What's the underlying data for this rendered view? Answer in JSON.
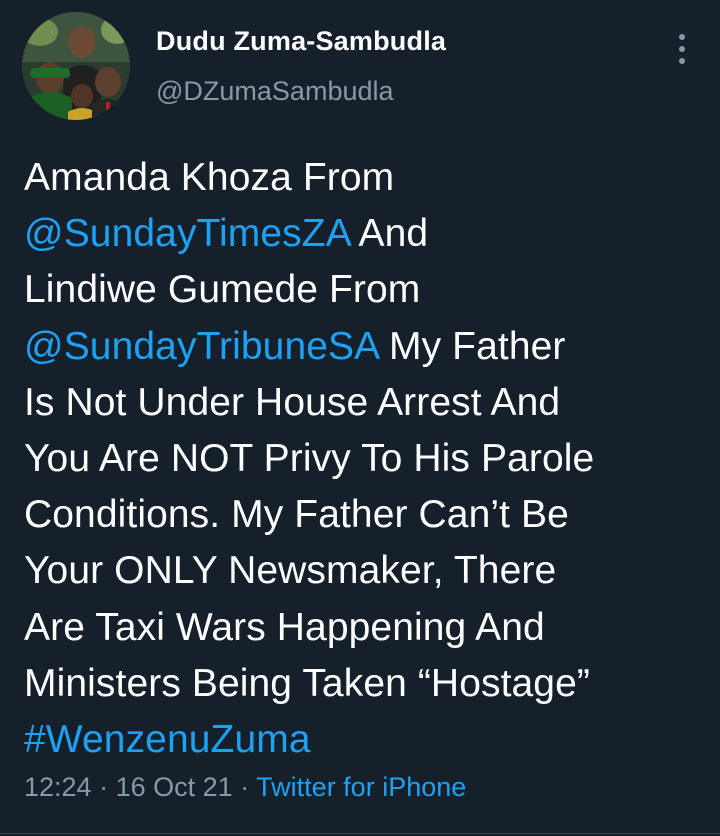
{
  "author": {
    "display_name": "Dudu Zuma-Sambudla",
    "handle": "@DZumaSambudla"
  },
  "menu": {
    "icon": "more-vertical-icon"
  },
  "tweet": {
    "lines": [
      [
        {
          "t": "Amanda Khoza From",
          "k": "text"
        }
      ],
      [
        {
          "t": "@SundayTimesZA",
          "k": "mention"
        },
        {
          "t": " And",
          "k": "text"
        }
      ],
      [
        {
          "t": "Lindiwe Gumede From",
          "k": "text"
        }
      ],
      [
        {
          "t": "@SundayTribuneSA",
          "k": "mention"
        },
        {
          "t": " My Father",
          "k": "text"
        }
      ],
      [
        {
          "t": "Is Not Under House Arrest And",
          "k": "text"
        }
      ],
      [
        {
          "t": "You Are NOT Privy To His Parole",
          "k": "text"
        }
      ],
      [
        {
          "t": "Conditions. My Father Can’t Be",
          "k": "text"
        }
      ],
      [
        {
          "t": "Your ONLY Newsmaker, There",
          "k": "text"
        }
      ],
      [
        {
          "t": "Are Taxi Wars Happening And",
          "k": "text"
        }
      ],
      [
        {
          "t": "Ministers Being Taken “Hostage”",
          "k": "text"
        }
      ],
      [
        {
          "t": "#WenzenuZuma",
          "k": "hashtag"
        }
      ]
    ]
  },
  "meta": {
    "time": "12:24",
    "sep1": " · ",
    "date": "16 Oct 21",
    "sep2": " · ",
    "source": "Twitter for iPhone"
  },
  "colors": {
    "background": "#15202b",
    "link": "#1da1f2",
    "secondary_text": "#8899a6",
    "primary_text": "#ffffff"
  }
}
